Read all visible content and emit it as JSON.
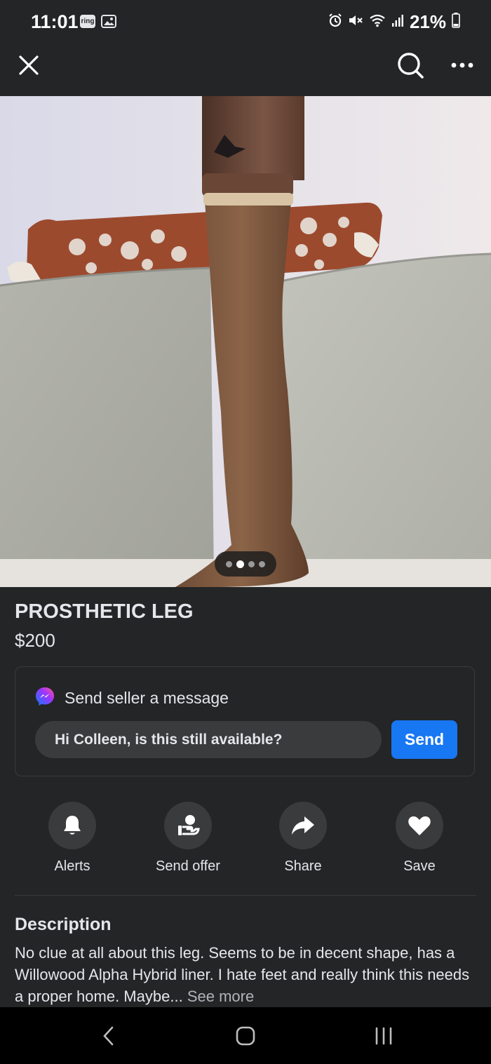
{
  "status_bar": {
    "time": "11:01",
    "ring_label": "ring",
    "battery_text": "21%",
    "icons": [
      "ring-app-icon",
      "gallery-icon",
      "alarm-icon",
      "mute-icon",
      "wifi-icon",
      "signal-icon",
      "battery-icon"
    ]
  },
  "top_bar": {
    "icons": [
      "close-icon",
      "search-icon",
      "more-options-icon"
    ]
  },
  "listing": {
    "photo_count": 4,
    "active_photo_index": 1,
    "title": "PROSTHETIC LEG",
    "price": "$200"
  },
  "message_card": {
    "header": "Send seller a message",
    "input_value": "Hi Colleen, is this still available?",
    "send_label": "Send",
    "accent": "#1877f2"
  },
  "actions": [
    {
      "label": "Alerts",
      "icon": "bell-icon"
    },
    {
      "label": "Send offer",
      "icon": "offer-icon"
    },
    {
      "label": "Share",
      "icon": "share-icon"
    },
    {
      "label": "Save",
      "icon": "heart-icon"
    }
  ],
  "description": {
    "heading": "Description",
    "text": "No clue at all about this leg. Seems to be in decent shape, has a Willowood Alpha Hybrid liner. I hate feet and really think this needs a proper home. Maybe...",
    "see_more": "See more"
  },
  "nav_bar": {
    "icons": [
      "back-icon",
      "home-icon",
      "recent-apps-icon"
    ]
  }
}
